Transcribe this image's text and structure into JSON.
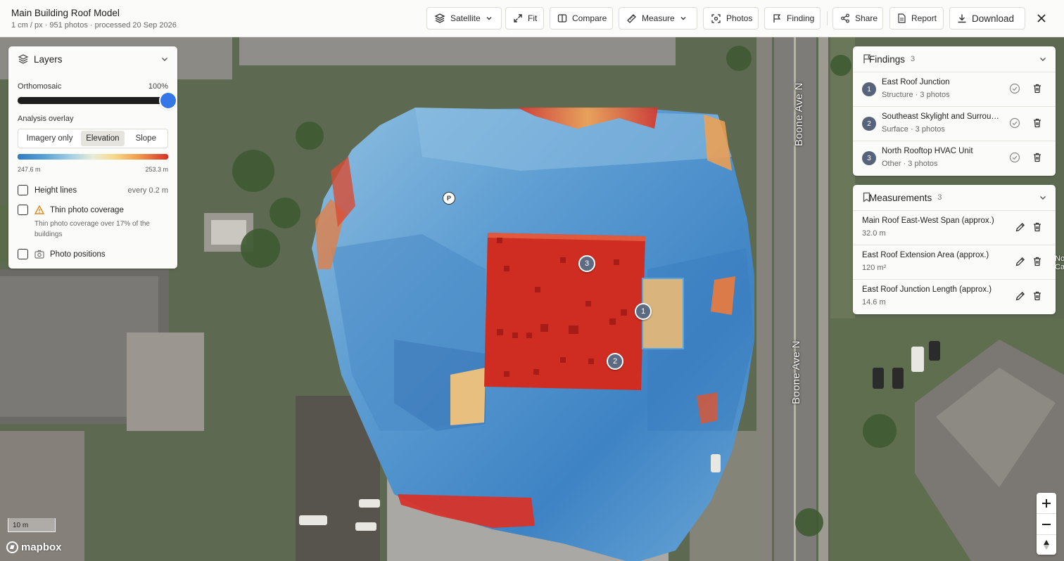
{
  "header": {
    "title": "Main Building Roof Model",
    "subtitle": "1 cm / px · 951 photos · processed 20 Sep 2026"
  },
  "toolbar": {
    "satellite": "Satellite",
    "fit": "Fit",
    "compare": "Compare",
    "measure": "Measure",
    "photos": "Photos",
    "finding": "Finding",
    "share": "Share",
    "report": "Report",
    "download": "Download"
  },
  "layers": {
    "title": "Layers",
    "orthomosaic_label": "Orthomosaic",
    "orthomosaic_value": "100%",
    "orthomosaic_level": 1.0,
    "overlay_label": "Analysis overlay",
    "overlay_options": [
      "Imagery only",
      "Elevation",
      "Slope"
    ],
    "overlay_selected": "Elevation",
    "ramp_min": "247.6 m",
    "ramp_max": "253.3 m",
    "height_lines_label": "Height lines",
    "height_lines_meta": "every 0.2 m",
    "height_lines_checked": false,
    "thin_coverage_label": "Thin photo coverage",
    "thin_coverage_desc": "Thin photo coverage over 17% of the buildings",
    "thin_coverage_checked": false,
    "photo_positions_label": "Photo positions",
    "photo_positions_checked": false
  },
  "findings": {
    "title": "Findings",
    "count": "3",
    "items": [
      {
        "num": "1",
        "title": "East Roof Junction",
        "sub": "Structure · 3 photos"
      },
      {
        "num": "2",
        "title": "Southeast Skylight and Surrou…",
        "sub": "Surface · 3 photos"
      },
      {
        "num": "3",
        "title": "North Rooftop HVAC Unit",
        "sub": "Other · 3 photos"
      }
    ]
  },
  "measurements": {
    "title": "Measurements",
    "count": "3",
    "items": [
      {
        "title": "Main Roof East-West Span (approx.)",
        "value": "32.0 m"
      },
      {
        "title": "East Roof Extension Area (approx.)",
        "value": "120 m²"
      },
      {
        "title": "East Roof Junction Length (approx.)",
        "value": "14.6 m"
      }
    ]
  },
  "map": {
    "street_1": "Boone Ave N",
    "street_2": "Boone Ave N",
    "edge_label_1": "No",
    "edge_label_2": "Ca",
    "parking_pin": "P",
    "scale_label": "10 m",
    "attribution": "mapbox",
    "markers": [
      "1",
      "2",
      "3"
    ]
  },
  "colors": {
    "accent": "#3577e6",
    "marker": "#5c6a82",
    "badge": "#57637a",
    "roof_high": "#d22f22",
    "roof_low": "#3b7fc2"
  }
}
